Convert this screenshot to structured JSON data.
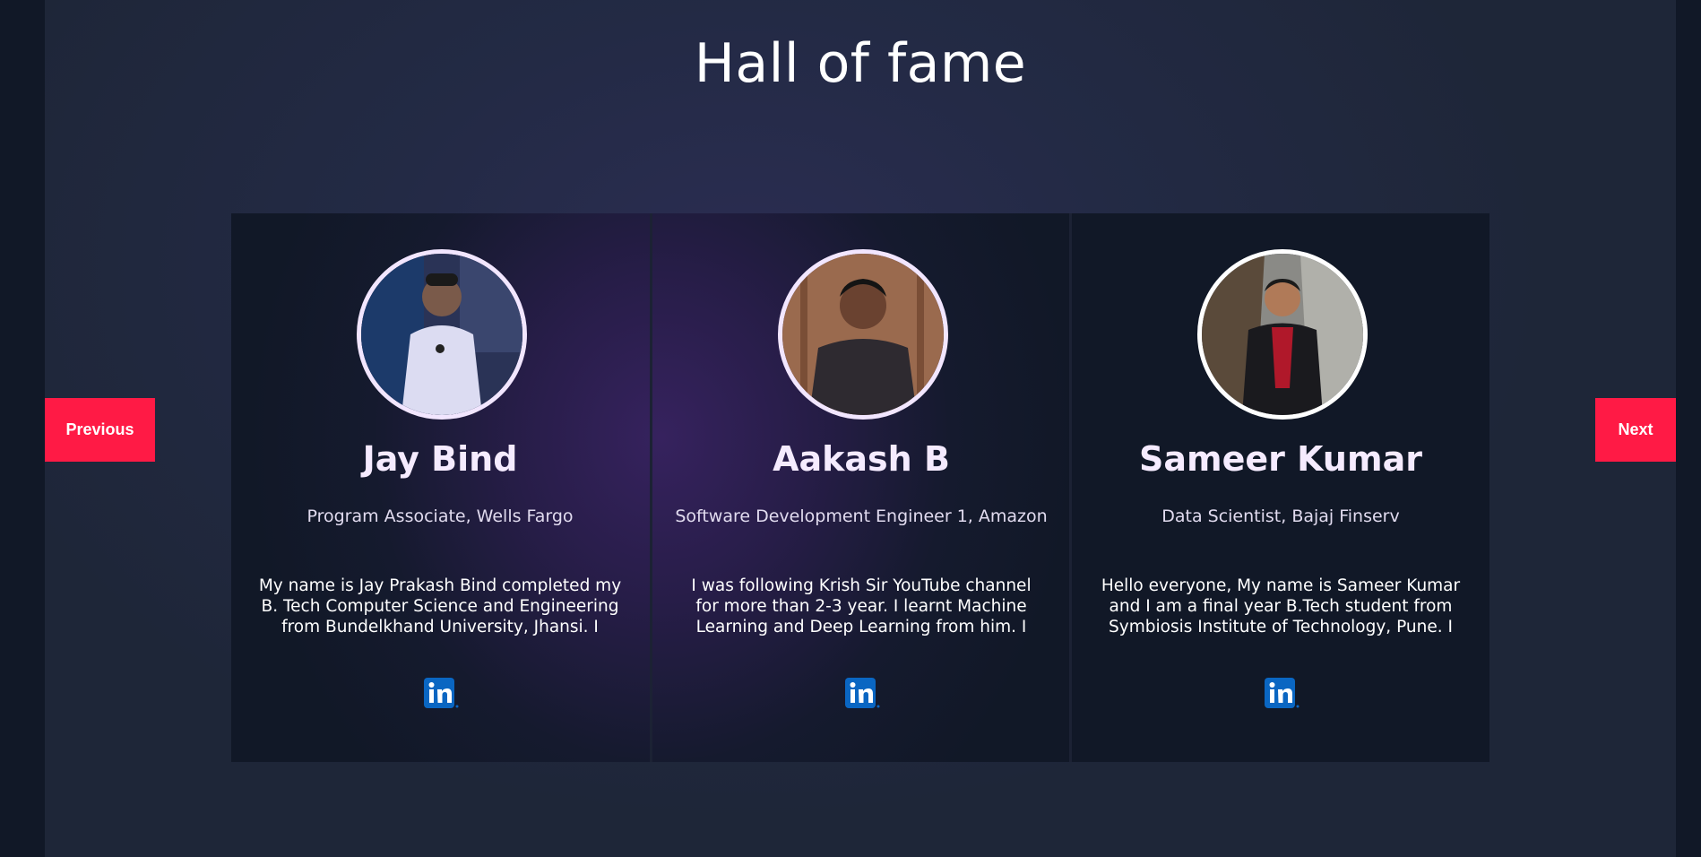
{
  "page": {
    "title": "Hall of fame"
  },
  "nav": {
    "previous_label": "Previous",
    "next_label": "Next"
  },
  "colors": {
    "accent": "#ff1a45",
    "linkedin": "#0a66c2",
    "avatar_ring": "#f2e6ff"
  },
  "cards": [
    {
      "name": "Jay Bind",
      "role": "Program Associate, Wells Fargo",
      "bio": "My name is Jay Prakash Bind completed my B. Tech Computer Science and Engineering from Bundelkhand University, Jhansi. I",
      "icon": "linkedin-icon"
    },
    {
      "name": "Aakash B",
      "role": "Software Development Engineer 1, Amazon",
      "bio": "I was following Krish Sir YouTube channel for more than 2-3 year. I learnt Machine Learning and Deep Learning from him. I learnt basics of",
      "icon": "linkedin-icon"
    },
    {
      "name": "Sameer Kumar",
      "role": "Data Scientist, Bajaj Finserv",
      "bio": "Hello everyone, My name is Sameer Kumar and I am a final year B.Tech student from Symbiosis Institute of Technology, Pune. I",
      "icon": "linkedin-icon"
    }
  ]
}
